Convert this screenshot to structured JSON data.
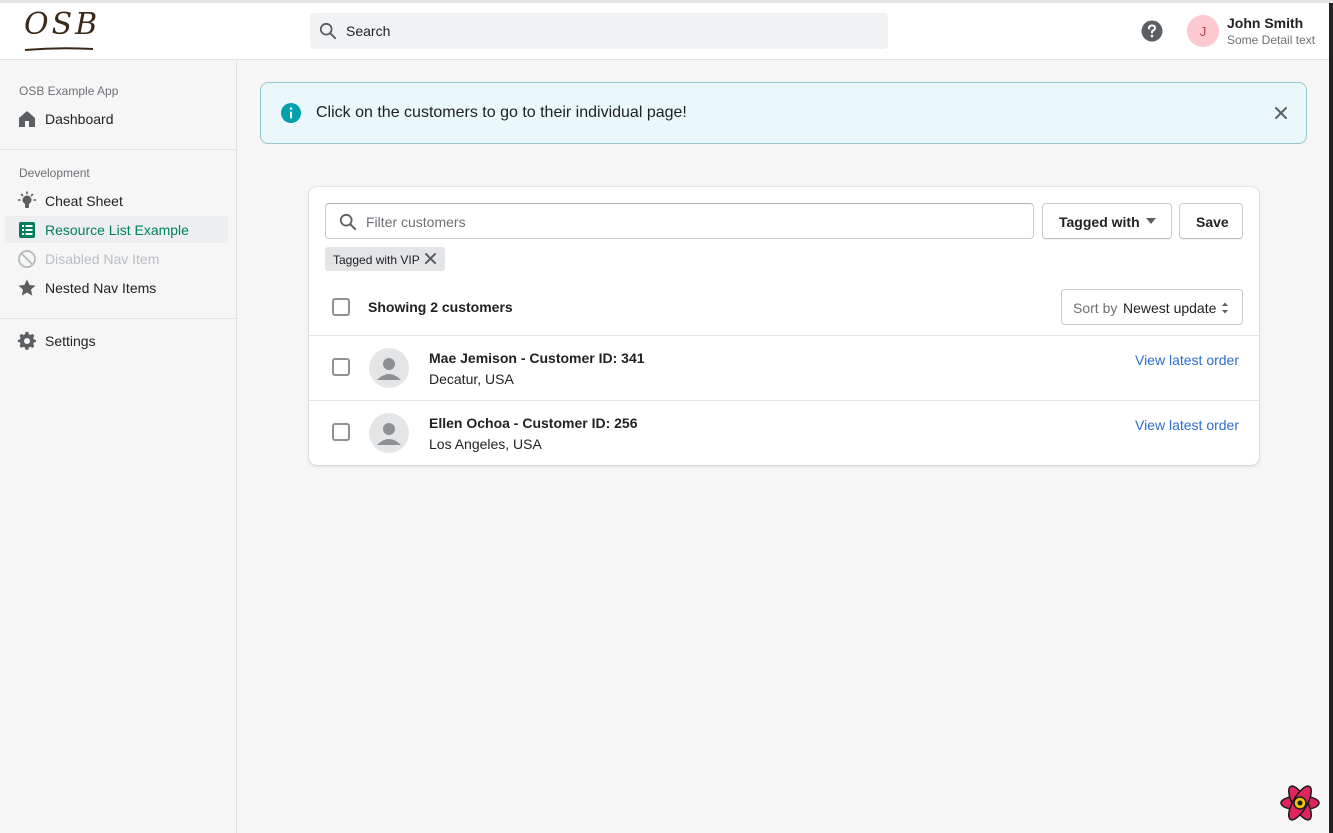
{
  "header": {
    "logo_text": "OSB",
    "search_placeholder": "Search",
    "user": {
      "initial": "J",
      "name": "John Smith",
      "detail": "Some Detail text"
    }
  },
  "sidebar": {
    "sections": [
      {
        "title": "OSB Example App",
        "items": [
          {
            "label": "Dashboard",
            "icon": "home-icon"
          }
        ]
      },
      {
        "title": "Development",
        "items": [
          {
            "label": "Cheat Sheet",
            "icon": "lightbulb-icon"
          },
          {
            "label": "Resource List Example",
            "icon": "list-icon",
            "active": true
          },
          {
            "label": "Disabled Nav Item",
            "icon": "disabled-icon",
            "disabled": true
          },
          {
            "label": "Nested Nav Items",
            "icon": "star-icon"
          }
        ]
      },
      {
        "title": "",
        "items": [
          {
            "label": "Settings",
            "icon": "gear-icon"
          }
        ]
      }
    ]
  },
  "banner": {
    "text": "Click on the customers to go to their individual page!"
  },
  "resource_list": {
    "filter_placeholder": "Filter customers",
    "tagged_with_label": "Tagged with",
    "save_label": "Save",
    "applied_tag": "Tagged with VIP",
    "showing_text": "Showing 2 customers",
    "sort_prefix": "Sort by",
    "sort_value": "Newest update",
    "customers": [
      {
        "name": "Mae Jemison - Customer ID: 341",
        "location": "Decatur, USA",
        "action": "View latest order"
      },
      {
        "name": "Ellen Ochoa - Customer ID: 256",
        "location": "Los Angeles, USA",
        "action": "View latest order"
      }
    ]
  },
  "colors": {
    "accent": "#007f5f",
    "link": "#2c6ecb",
    "info": "#00a0ac"
  }
}
